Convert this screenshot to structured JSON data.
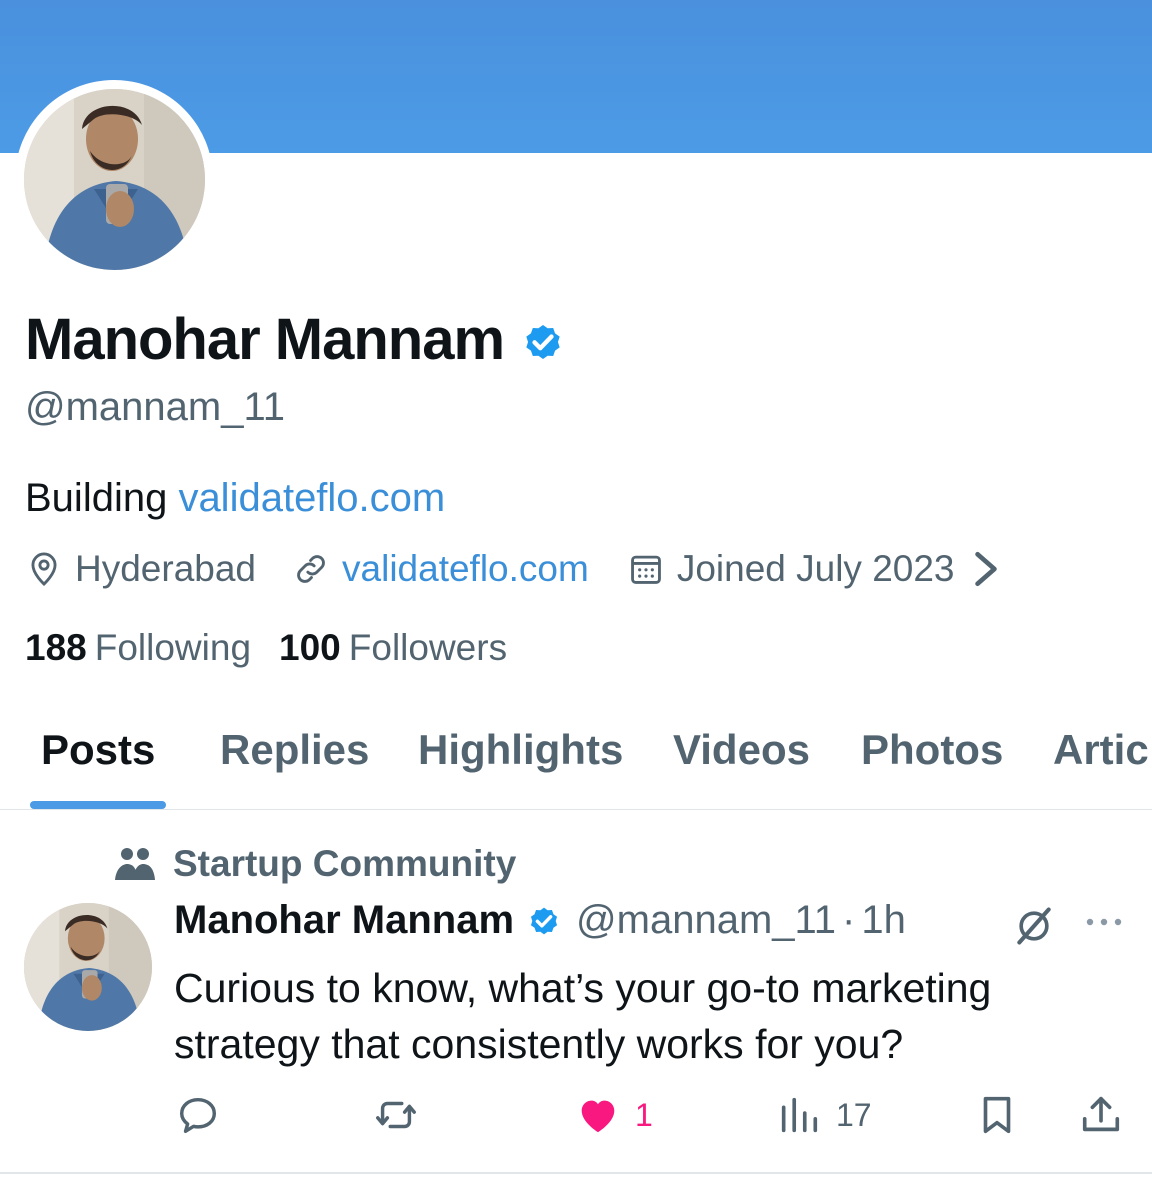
{
  "profile": {
    "display_name": "Manohar Mannam",
    "handle": "@mannam_11",
    "bio_prefix": "Building ",
    "bio_link": "validateflo.com",
    "location": "Hyderabad",
    "website": "validateflo.com",
    "joined": "Joined July 2023",
    "following_count": "188",
    "following_label": "Following",
    "followers_count": "100",
    "followers_label": "Followers"
  },
  "tabs": [
    {
      "label": "Posts",
      "active": true
    },
    {
      "label": "Replies"
    },
    {
      "label": "Highlights"
    },
    {
      "label": "Videos"
    },
    {
      "label": "Photos"
    },
    {
      "label": "Artic"
    }
  ],
  "post": {
    "community": "Startup Community",
    "author_name": "Manohar Mannam",
    "author_handle": "@mannam_11",
    "separator": "·",
    "time": "1h",
    "text": "Curious to know, what’s your go-to marketing strategy that consistently works for you?",
    "likes": "1",
    "views": "17"
  },
  "colors": {
    "banner": "#4a90dd",
    "link": "#3a8fd8",
    "like": "#f91880",
    "verified": "#1d9bf0"
  },
  "icons": [
    "verified-badge-icon",
    "location-pin-icon",
    "link-icon",
    "calendar-icon",
    "chevron-right-icon",
    "community-icon",
    "grok-icon",
    "more-icon",
    "reply-icon",
    "repost-icon",
    "heart-icon",
    "views-icon",
    "bookmark-icon",
    "share-icon"
  ]
}
